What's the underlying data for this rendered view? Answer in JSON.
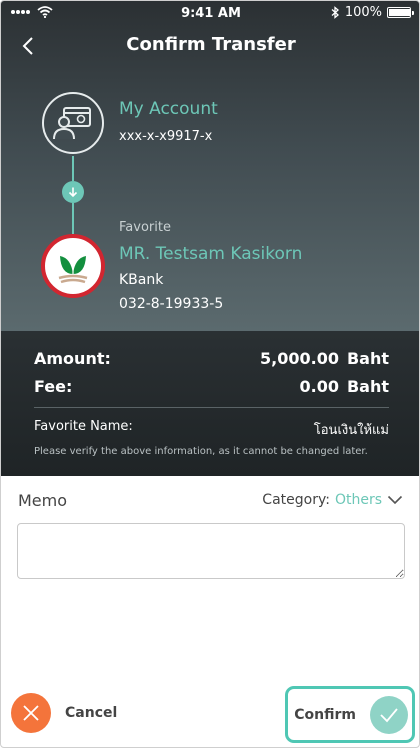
{
  "status_bar": {
    "time": "9:41 AM",
    "battery": "100%",
    "battery_level": 1.0
  },
  "header": {
    "title": "Confirm Transfer"
  },
  "from": {
    "name": "My Account",
    "account": "xxx-x-x9917-x"
  },
  "to": {
    "label": "Favorite",
    "name": "MR. Testsam Kasikorn",
    "bank": "KBank",
    "account": "032-8-19933-5"
  },
  "summary": {
    "amount_label": "Amount:",
    "amount_value": "5,000.00",
    "fee_label": "Fee:",
    "fee_value": "0.00",
    "currency": "Baht",
    "favorite_name_label": "Favorite Name:",
    "favorite_name_value": "โอนเงินให้แม่",
    "note": "Please verify the above information, as it cannot be changed later."
  },
  "memo": {
    "label": "Memo",
    "category_label": "Category:",
    "category_value": "Others",
    "value": ""
  },
  "actions": {
    "cancel": "Cancel",
    "confirm": "Confirm"
  },
  "colors": {
    "accent": "#6dc7b7",
    "cancel": "#f4743b",
    "confirm_border": "#4fc7b4",
    "kbank_red": "#d22630",
    "kbank_green": "#138f3e"
  }
}
